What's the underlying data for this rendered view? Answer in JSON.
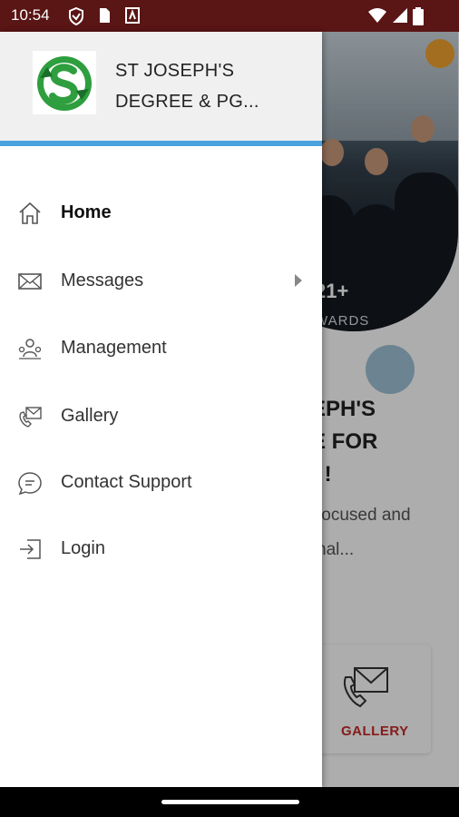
{
  "status_bar": {
    "time": "10:54"
  },
  "drawer": {
    "title": "ST JOSEPH'S\nDEGREE & PG...",
    "items": [
      {
        "label": "Home",
        "icon": "home-icon",
        "active": true
      },
      {
        "label": "Messages",
        "icon": "mail-icon",
        "has_submenu": true
      },
      {
        "label": "Management",
        "icon": "people-icon"
      },
      {
        "label": "Gallery",
        "icon": "gallery-icon"
      },
      {
        "label": "Contact Support",
        "icon": "chat-icon"
      },
      {
        "label": "Login",
        "icon": "login-icon"
      }
    ]
  },
  "background": {
    "awards_count": "21+",
    "awards_label": "WARDS",
    "heading": "EPH'S\nE FOR\n) !",
    "text": "focused and\nnal...",
    "gallery_label": "GALLERY"
  },
  "colors": {
    "status_bar": "#5a1515",
    "accent_line": "#4aa3df",
    "gallery": "#c62828"
  }
}
